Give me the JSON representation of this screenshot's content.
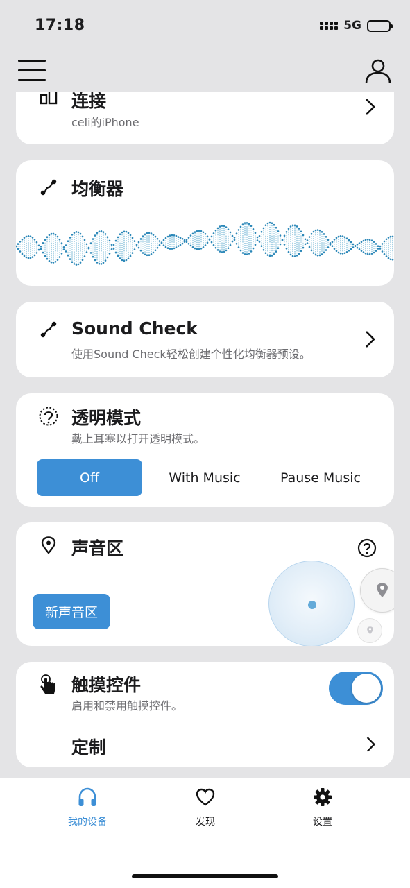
{
  "status_bar": {
    "time": "17:18",
    "network": "5G"
  },
  "colors": {
    "accent": "#3d8fd6",
    "card": "#ffffff",
    "background": "#e4e4e6"
  },
  "icons": {
    "menu": "hamburger-menu-icon",
    "profile": "user-profile-icon",
    "connection": "device-connection-icon",
    "equalizer": "equalizer-curve-icon",
    "sound_check": "sound-check-curve-icon",
    "transparency": "ear-transparency-icon",
    "zone": "location-pin-icon",
    "help": "question-circle-icon",
    "touch": "touch-hand-icon",
    "tab_device": "headphones-icon",
    "tab_discover": "heart-icon",
    "tab_settings": "gear-icon"
  },
  "connection": {
    "title": "连接",
    "device": "celi的iPhone"
  },
  "equalizer": {
    "title": "均衡器"
  },
  "sound_check": {
    "title": "Sound Check",
    "subtitle": "使用Sound Check轻松创建个性化均衡器预设。"
  },
  "transparency": {
    "title": "透明模式",
    "subtitle": "戴上耳塞以打开透明模式。",
    "options": [
      "Off",
      "With Music",
      "Pause Music"
    ],
    "selected": "Off"
  },
  "sound_zones": {
    "title": "声音区",
    "new_zone_label": "新声音区"
  },
  "touch_controls": {
    "title": "触摸控件",
    "subtitle": "启用和禁用触摸控件。",
    "enabled": true,
    "customize_label": "定制"
  },
  "tabs": [
    {
      "label": "我的设备",
      "active": true
    },
    {
      "label": "发现",
      "active": false
    },
    {
      "label": "设置",
      "active": false
    }
  ]
}
